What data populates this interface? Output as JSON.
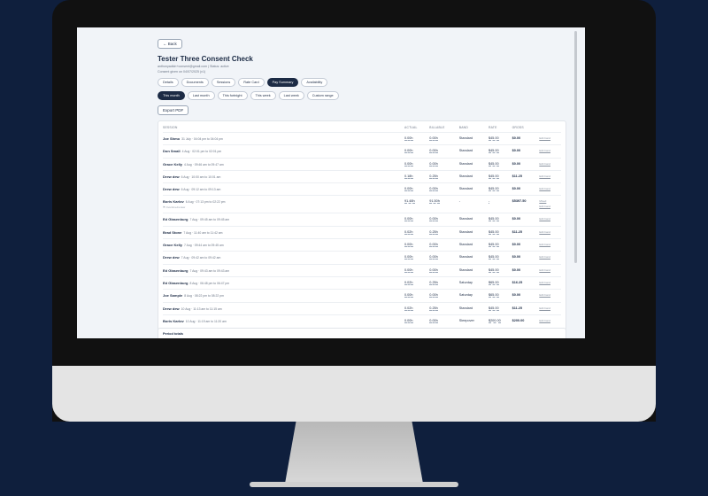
{
  "header": {
    "back_label": "← Back",
    "title": "Tester Three Consent Check",
    "meta_line1": "anthonyadkin+consent@gmail.com  |  Status: active",
    "meta_line2": "Consent given on 04/07/2025 (v1)"
  },
  "tabs": [
    {
      "label": "Details",
      "active": false
    },
    {
      "label": "Documents",
      "active": false
    },
    {
      "label": "Sessions",
      "active": false
    },
    {
      "label": "Rate Card",
      "active": false
    },
    {
      "label": "Pay Summary",
      "active": true
    },
    {
      "label": "Availability",
      "active": false
    }
  ],
  "ranges": [
    {
      "label": "This month",
      "active": true
    },
    {
      "label": "Last month",
      "active": false
    },
    {
      "label": "This fortnight",
      "active": false
    },
    {
      "label": "This week",
      "active": false
    },
    {
      "label": "Last week",
      "active": false
    },
    {
      "label": "Custom range",
      "active": false
    }
  ],
  "export_label": "Export PDF",
  "table": {
    "columns": [
      "SESSION",
      "ACTUAL",
      "BILLABLE",
      "BAND",
      "RATE",
      "GROSS",
      ""
    ],
    "rows": [
      {
        "name": "Joe Shmo",
        "when": "31 July · 04:04 pm to 04:04 pm",
        "actual": "0.00h",
        "billable": "0.00h",
        "band": "Standard",
        "rate": "$45.00",
        "gross": "$0.00",
        "action": "Edit band"
      },
      {
        "name": "Don Small",
        "when": "4 Aug · 02:01 pm to 02:01 pm",
        "actual": "0.00h",
        "billable": "0.00h",
        "band": "Standard",
        "rate": "$45.00",
        "gross": "$0.00",
        "action": "Edit band"
      },
      {
        "name": "Grace Kelly",
        "when": "4 Aug · 09:46 am to 09:47 am",
        "actual": "0.00h",
        "billable": "0.00h",
        "band": "Standard",
        "rate": "$45.00",
        "gross": "$0.00",
        "action": "Edit band"
      },
      {
        "name": "Drew dew",
        "when": "6 Aug · 10:00 am to 10:01 am",
        "actual": "0.18h",
        "billable": "0.25h",
        "band": "Standard",
        "rate": "$45.00",
        "gross": "$11.25",
        "action": "Edit band"
      },
      {
        "name": "Drew dew",
        "when": "6 Aug · 09:12 am to 09:13 am",
        "actual": "0.00h",
        "billable": "0.00h",
        "band": "Standard",
        "rate": "$45.00",
        "gross": "$0.00",
        "action": "Edit band"
      },
      {
        "name": "Boris Karlov",
        "when": "6 Aug · 07:13 pm to 02:22 pm",
        "sub": "⚑ Overtime/review",
        "actual": "91.48h",
        "billable": "91.50h",
        "band": "-",
        "rate": "-",
        "gross": "$5397.50",
        "action_top": "Mixed",
        "action": "Edit band"
      },
      {
        "name": "Ed Glasenburg",
        "when": "7 Aug · 09:45 am to 09:45 am",
        "actual": "0.00h",
        "billable": "0.00h",
        "band": "Standard",
        "rate": "$45.00",
        "gross": "$0.00",
        "action": "Edit band"
      },
      {
        "name": "Brad Stone",
        "when": "7 Aug · 11:40 am to 11:42 am",
        "actual": "0.02h",
        "billable": "0.25h",
        "band": "Standard",
        "rate": "$45.00",
        "gross": "$11.25",
        "action": "Edit band"
      },
      {
        "name": "Grace Kelly",
        "when": "7 Aug · 09:44 am to 09:45 am",
        "actual": "0.00h",
        "billable": "0.00h",
        "band": "Standard",
        "rate": "$45.00",
        "gross": "$0.00",
        "action": "Edit band"
      },
      {
        "name": "Drew dew",
        "when": "7 Aug · 09:42 am to 09:42 am",
        "actual": "0.00h",
        "billable": "0.00h",
        "band": "Standard",
        "rate": "$45.00",
        "gross": "$0.00",
        "action": "Edit band"
      },
      {
        "name": "Ed Glasenburg",
        "when": "7 Aug · 09:43 am to 09:43 am",
        "actual": "0.00h",
        "billable": "0.00h",
        "band": "Standard",
        "rate": "$45.00",
        "gross": "$0.00",
        "action": "Edit band"
      },
      {
        "name": "Ed Glasenburg",
        "when": "8 Aug · 06:48 pm to 06:47 pm",
        "actual": "0.02h",
        "billable": "0.25h",
        "band": "Saturday",
        "rate": "$65.00",
        "gross": "$16.25",
        "action": "Edit band"
      },
      {
        "name": "Joe Sample",
        "when": "8 Aug · 08:22 pm to 08:22 pm",
        "actual": "0.00h",
        "billable": "0.00h",
        "band": "Saturday",
        "rate": "$65.00",
        "gross": "$0.00",
        "action": "Edit band"
      },
      {
        "name": "Drew dew",
        "when": "10 Aug · 11:13 am to 11:15 am",
        "actual": "0.02h",
        "billable": "0.25h",
        "band": "Standard",
        "rate": "$45.00",
        "gross": "$11.25",
        "action": "Edit band"
      },
      {
        "name": "Boris Karlov",
        "when": "10 Aug · 11:19 am to 11:20 am",
        "actual": "0.00h",
        "billable": "0.00h",
        "band": "Sleepover",
        "rate": "$200.00",
        "gross": "$200.00",
        "action": "Edit band"
      }
    ]
  },
  "period_title": "Period totals",
  "colors": {
    "navy": "#1c2b45",
    "background": "#0f1f3d"
  }
}
